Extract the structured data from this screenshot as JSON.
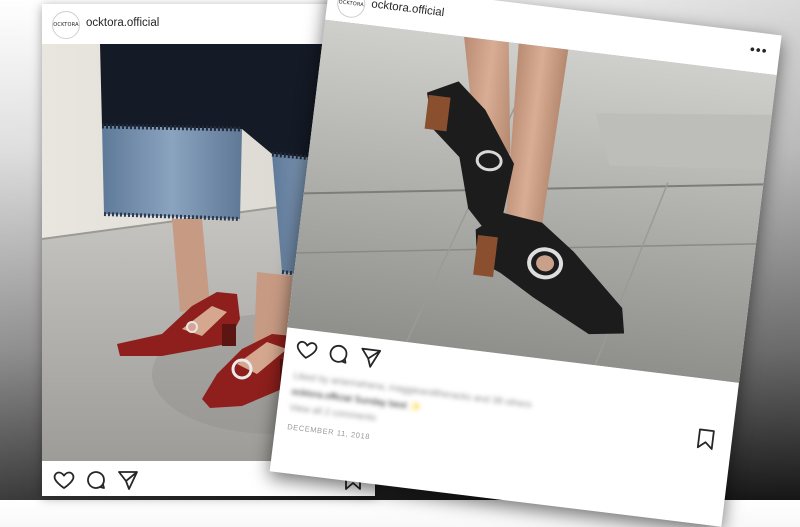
{
  "posts": [
    {
      "username": "ocktora.official",
      "avatar_text": "OCKTORA",
      "more_label": "•••",
      "icons": [
        "heart-icon",
        "comment-icon",
        "share-icon",
        "bookmark-icon"
      ]
    },
    {
      "username": "ocktora.official",
      "avatar_text": "OCKTORA",
      "more_label": "•••",
      "icons": [
        "heart-icon",
        "comment-icon",
        "share-icon",
        "bookmark-icon"
      ],
      "liked_by": "Liked by ariannahana, maggieandtheracks and 38 others",
      "caption": "ocktora.official Sunday best ✨",
      "comments_link": "View all 2 comments",
      "date": "DECEMBER 11, 2018"
    }
  ],
  "colors": {
    "accent_shoe_red": "#8e1f1c",
    "shoe_black": "#1c1c1c",
    "denim": "#6f8bab"
  }
}
